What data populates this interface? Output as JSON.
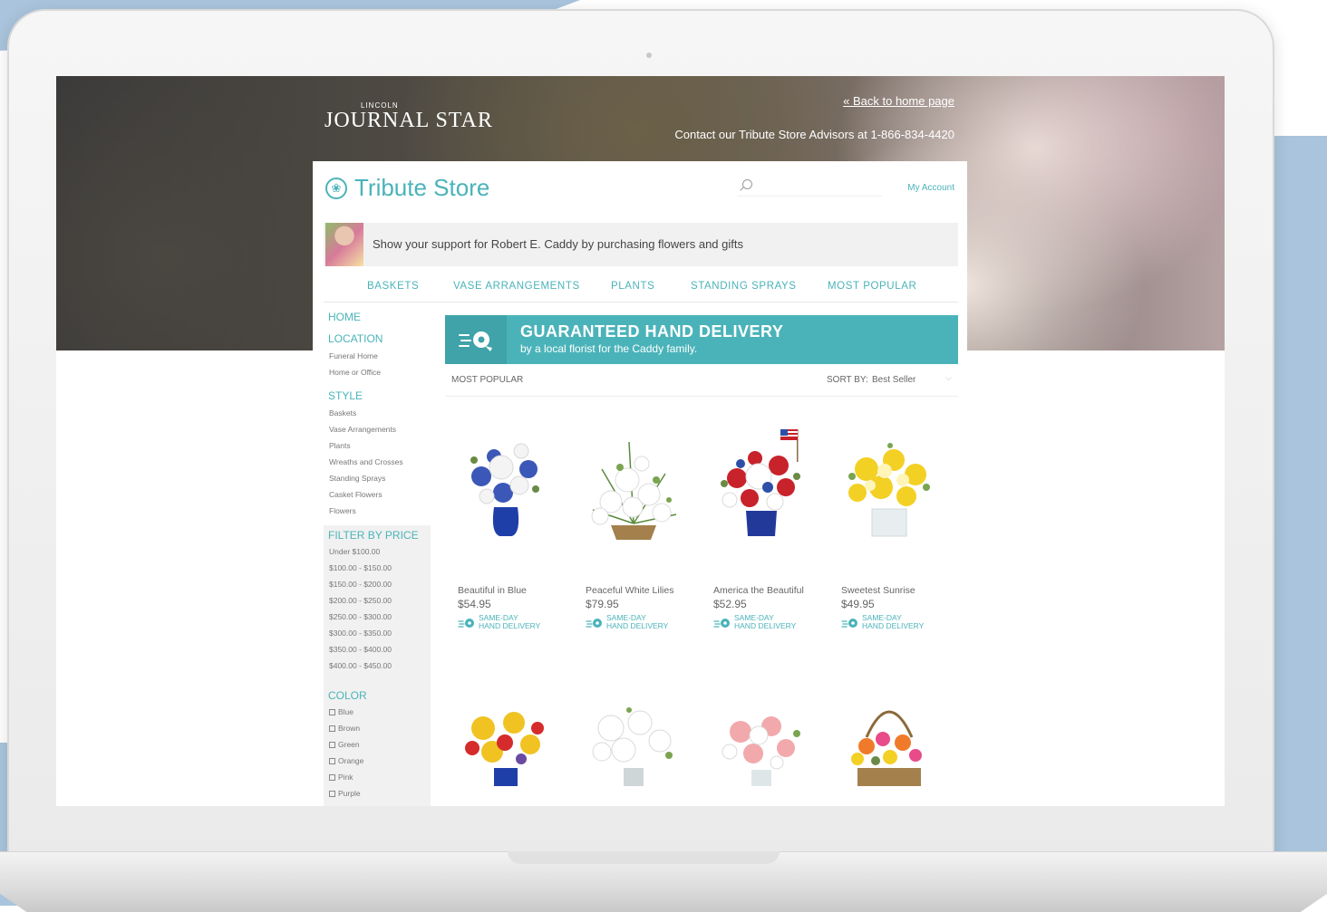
{
  "site": {
    "logo_top": "LINCOLN",
    "logo": "JOURNAL STAR",
    "back_link": "« Back to home page",
    "contact": "Contact our Tribute Store Advisors at 1-866-834-4420"
  },
  "store": {
    "title": "Tribute Store",
    "search_placeholder": "",
    "my_account": "My Account",
    "support_text": "Show your support for Robert E. Caddy by purchasing flowers and gifts"
  },
  "topnav": [
    "BASKETS",
    "VASE ARRANGEMENTS",
    "PLANTS",
    "STANDING SPRAYS",
    "MOST POPULAR"
  ],
  "sidebar": {
    "home": "HOME",
    "location": {
      "heading": "LOCATION",
      "items": [
        "Funeral Home",
        "Home or Office"
      ]
    },
    "style": {
      "heading": "STYLE",
      "items": [
        "Baskets",
        "Vase Arrangements",
        "Plants",
        "Wreaths and Crosses",
        "Standing Sprays",
        "Casket Flowers",
        "Flowers"
      ]
    },
    "price": {
      "heading": "FILTER BY PRICE",
      "items": [
        "Under $100.00",
        "$100.00 - $150.00",
        "$150.00 - $200.00",
        "$200.00 - $250.00",
        "$250.00 - $300.00",
        "$300.00 - $350.00",
        "$350.00 - $400.00",
        "$400.00 - $450.00"
      ]
    },
    "color": {
      "heading": "COLOR",
      "items": [
        "Blue",
        "Brown",
        "Green",
        "Orange",
        "Pink",
        "Purple"
      ]
    }
  },
  "delivery_banner": {
    "title": "GUARANTEED HAND DELIVERY",
    "subtitle": "by a local florist for the Caddy family."
  },
  "listing": {
    "label": "MOST POPULAR",
    "sort_label": "SORT BY:",
    "sort_value": "Best Seller"
  },
  "products": [
    {
      "name": "Beautiful in Blue",
      "price": "$54.95",
      "badge_line1": "SAME-DAY",
      "badge_line2": "HAND DELIVERY"
    },
    {
      "name": "Peaceful White Lilies",
      "price": "$79.95",
      "badge_line1": "SAME-DAY",
      "badge_line2": "HAND DELIVERY"
    },
    {
      "name": "America the Beautiful",
      "price": "$52.95",
      "badge_line1": "SAME-DAY",
      "badge_line2": "HAND DELIVERY"
    },
    {
      "name": "Sweetest Sunrise",
      "price": "$49.95",
      "badge_line1": "SAME-DAY",
      "badge_line2": "HAND DELIVERY"
    }
  ],
  "colors": {
    "accent": "#4ab3b9",
    "background_blob": "#a9c4dc",
    "text": "#666666"
  }
}
